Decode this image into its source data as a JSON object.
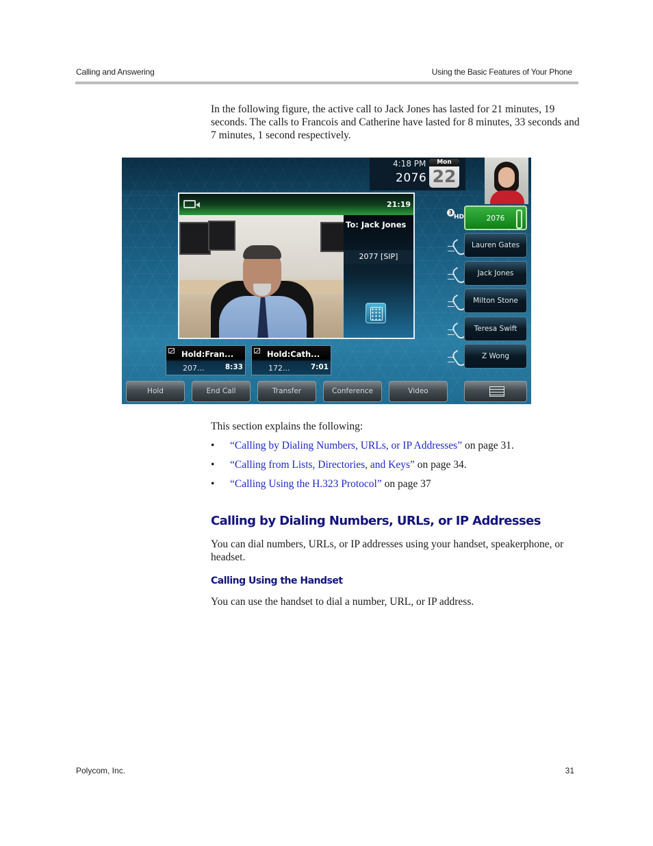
{
  "header": {
    "left": "Calling and Answering",
    "right": "Using the Basic Features of Your Phone"
  },
  "intro": "In the following figure, the active call to Jack Jones has lasted for 21 minutes, 19 seconds. The calls to Francois and Catherine have lasted for 8 minutes, 33 seconds and 7 minutes, 1 second respectively.",
  "phone_screen": {
    "time": "4:18 PM",
    "extension": "2076",
    "calendar": {
      "day": "Mon",
      "date": "22"
    },
    "active_call": {
      "icon": "video-camera-icon",
      "timer": "21:19",
      "to": "To: Jack Jones",
      "address": "2077 [SIP]",
      "keypad_icon": "dialpad-icon"
    },
    "hd_badge": {
      "count": "3",
      "label": "HD"
    },
    "lines": [
      {
        "label": "2076",
        "active": true
      },
      {
        "label": "Lauren Gates",
        "active": false
      },
      {
        "label": "Jack Jones",
        "active": false
      },
      {
        "label": "Milton Stone",
        "active": false
      },
      {
        "label": "Teresa Swift",
        "active": false
      },
      {
        "label": "Z Wong",
        "active": false
      }
    ],
    "held_calls": [
      {
        "title": "Hold:Fran...",
        "number": "207...",
        "time": "8:33"
      },
      {
        "title": "Hold:Cath...",
        "number": "172...",
        "time": "7:01"
      }
    ],
    "softkeys": [
      "Hold",
      "End Call",
      "Transfer",
      "Conference",
      "Video"
    ],
    "more_icon": "more-menu-icon",
    "colors": {
      "active_line": "#219a2c",
      "background": "#1a5f84"
    }
  },
  "explains": "This section explains the following:",
  "bullets": [
    {
      "link": "“Calling by Dialing Numbers, URLs, or IP Addresses”",
      "suffix": " on page 31."
    },
    {
      "link": "“Calling from Lists, Directories, and Keys”",
      "suffix": " on page 34."
    },
    {
      "link": "“Calling Using the H.323 Protocol”",
      "suffix": " on page 37"
    }
  ],
  "section": {
    "heading": "Calling by Dialing Numbers, URLs, or IP Addresses",
    "text": "You can dial numbers, URLs, or IP addresses using your handset, speakerphone, or headset.",
    "subheading": "Calling Using the Handset",
    "subtext": "You can use the handset to dial a number, URL, or IP address."
  },
  "footer": {
    "left": "Polycom, Inc.",
    "page": "31"
  },
  "colors": {
    "heading": "#13137d",
    "link": "#1f28c9",
    "rule": "#bdbdbd"
  }
}
